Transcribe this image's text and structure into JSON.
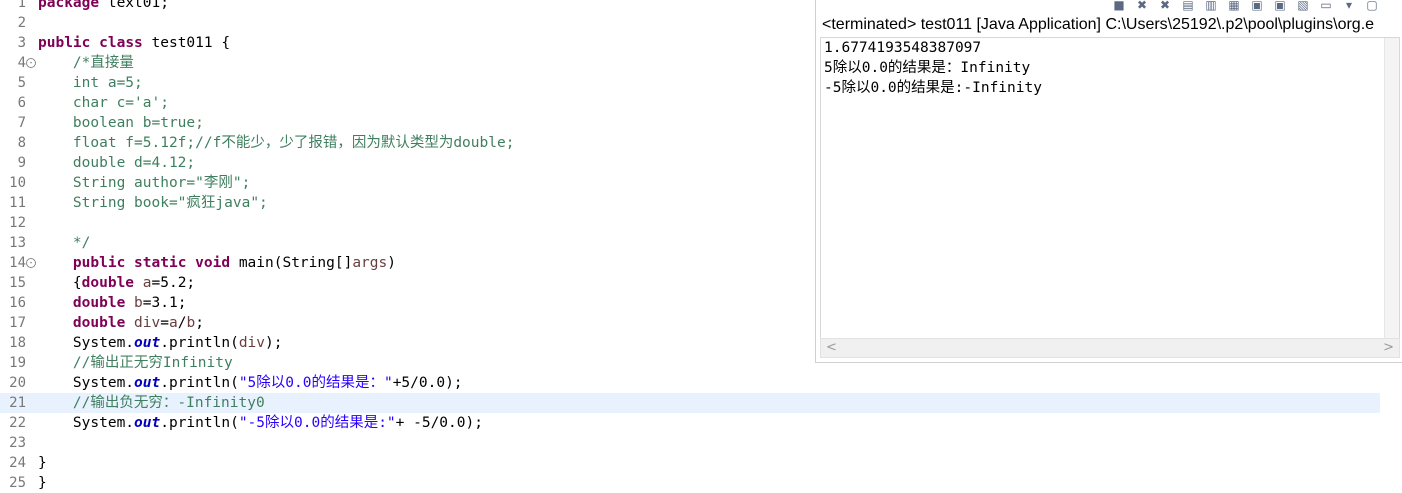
{
  "editor": {
    "lines": [
      {
        "n": "1",
        "segs": [
          [
            "kw",
            "package"
          ],
          [
            "plain",
            " text01;"
          ]
        ]
      },
      {
        "n": "2",
        "segs": []
      },
      {
        "n": "3",
        "segs": [
          [
            "kw",
            "public"
          ],
          [
            "plain",
            " "
          ],
          [
            "kw",
            "class"
          ],
          [
            "plain",
            " test011 {"
          ]
        ]
      },
      {
        "n": "4",
        "fold": "-",
        "segs": [
          [
            "plain",
            "    "
          ],
          [
            "cm",
            "/*直接量"
          ]
        ]
      },
      {
        "n": "5",
        "segs": [
          [
            "plain",
            "    "
          ],
          [
            "cm",
            "int a=5;"
          ]
        ]
      },
      {
        "n": "6",
        "segs": [
          [
            "plain",
            "    "
          ],
          [
            "cm",
            "char c='a';"
          ]
        ]
      },
      {
        "n": "7",
        "segs": [
          [
            "plain",
            "    "
          ],
          [
            "cm",
            "boolean b=true;"
          ]
        ]
      },
      {
        "n": "8",
        "segs": [
          [
            "plain",
            "    "
          ],
          [
            "cm",
            "float f=5.12f;//f不能少，少了报错，因为默认类型为double;"
          ]
        ]
      },
      {
        "n": "9",
        "segs": [
          [
            "plain",
            "    "
          ],
          [
            "cm",
            "double d=4.12;"
          ]
        ]
      },
      {
        "n": "10",
        "segs": [
          [
            "plain",
            "    "
          ],
          [
            "cm",
            "String author=\"李刚\";"
          ]
        ]
      },
      {
        "n": "11",
        "segs": [
          [
            "plain",
            "    "
          ],
          [
            "cm",
            "String book=\"疯狂java\";"
          ]
        ]
      },
      {
        "n": "12",
        "segs": []
      },
      {
        "n": "13",
        "segs": [
          [
            "plain",
            "    "
          ],
          [
            "cm",
            "*/"
          ]
        ]
      },
      {
        "n": "14",
        "fold": "-",
        "segs": [
          [
            "plain",
            "    "
          ],
          [
            "kw",
            "public"
          ],
          [
            "plain",
            " "
          ],
          [
            "kw",
            "static"
          ],
          [
            "plain",
            " "
          ],
          [
            "kw",
            "void"
          ],
          [
            "plain",
            " main(String[]"
          ],
          [
            "prm",
            "args"
          ],
          [
            "plain",
            ")"
          ]
        ]
      },
      {
        "n": "15",
        "segs": [
          [
            "plain",
            "    {"
          ],
          [
            "kw",
            "double"
          ],
          [
            "plain",
            " "
          ],
          [
            "prm",
            "a"
          ],
          [
            "plain",
            "=5.2;"
          ]
        ]
      },
      {
        "n": "16",
        "segs": [
          [
            "plain",
            "    "
          ],
          [
            "kw",
            "double"
          ],
          [
            "plain",
            " "
          ],
          [
            "prm",
            "b"
          ],
          [
            "plain",
            "=3.1;"
          ]
        ]
      },
      {
        "n": "17",
        "segs": [
          [
            "plain",
            "    "
          ],
          [
            "kw",
            "double"
          ],
          [
            "plain",
            " "
          ],
          [
            "prm",
            "div"
          ],
          [
            "plain",
            "="
          ],
          [
            "prm",
            "a"
          ],
          [
            "plain",
            "/"
          ],
          [
            "prm",
            "b"
          ],
          [
            "plain",
            ";"
          ]
        ]
      },
      {
        "n": "18",
        "segs": [
          [
            "plain",
            "    System."
          ],
          [
            "fld",
            "out"
          ],
          [
            "plain",
            ".println("
          ],
          [
            "prm",
            "div"
          ],
          [
            "plain",
            ");"
          ]
        ]
      },
      {
        "n": "19",
        "segs": [
          [
            "plain",
            "    "
          ],
          [
            "cm",
            "//输出正无穷Infinity"
          ]
        ]
      },
      {
        "n": "20",
        "segs": [
          [
            "plain",
            "    System."
          ],
          [
            "fld",
            "out"
          ],
          [
            "plain",
            ".println("
          ],
          [
            "st",
            "\"5除以0.0的结果是：\""
          ],
          [
            "plain",
            "+5/0.0);"
          ]
        ]
      },
      {
        "n": "21",
        "hl": true,
        "segs": [
          [
            "plain",
            "    "
          ],
          [
            "cm",
            "//输出负无穷：-Infinity0"
          ]
        ]
      },
      {
        "n": "22",
        "segs": [
          [
            "plain",
            "    System."
          ],
          [
            "fld",
            "out"
          ],
          [
            "plain",
            ".println("
          ],
          [
            "st",
            "\"-5除以0.0的结果是:\""
          ],
          [
            "plain",
            "+ -5/0.0);"
          ]
        ]
      },
      {
        "n": "23",
        "segs": []
      },
      {
        "n": "24",
        "segs": [
          [
            "plain",
            "}"
          ]
        ]
      },
      {
        "n": "25",
        "segs": [
          [
            "plain",
            "}"
          ]
        ]
      }
    ]
  },
  "console": {
    "title": "<terminated> test011 [Java Application] C:\\Users\\25192\\.p2\\pool\\plugins\\org.e",
    "output": [
      "1.6774193548387097",
      "5除以0.0的结果是：Infinity",
      "-5除以0.0的结果是:-Infinity"
    ],
    "toolbar_icons": [
      "terminate-icon",
      "remove-launch-icon",
      "remove-all-icon",
      "clear-console-icon",
      "scroll-lock-icon",
      "word-wrap-icon",
      "show-stdout-icon",
      "show-stderr-icon",
      "pin-console-icon",
      "display-console-icon",
      "display-console-menu-icon",
      "open-console-icon"
    ],
    "scroll_left": "<",
    "scroll_right": ">"
  },
  "colors": {
    "keyword": "#7f0055",
    "comment": "#3f7f5f",
    "string": "#2a00ff",
    "field": "#0000c0",
    "highlight_line": "#e8f2fe"
  }
}
